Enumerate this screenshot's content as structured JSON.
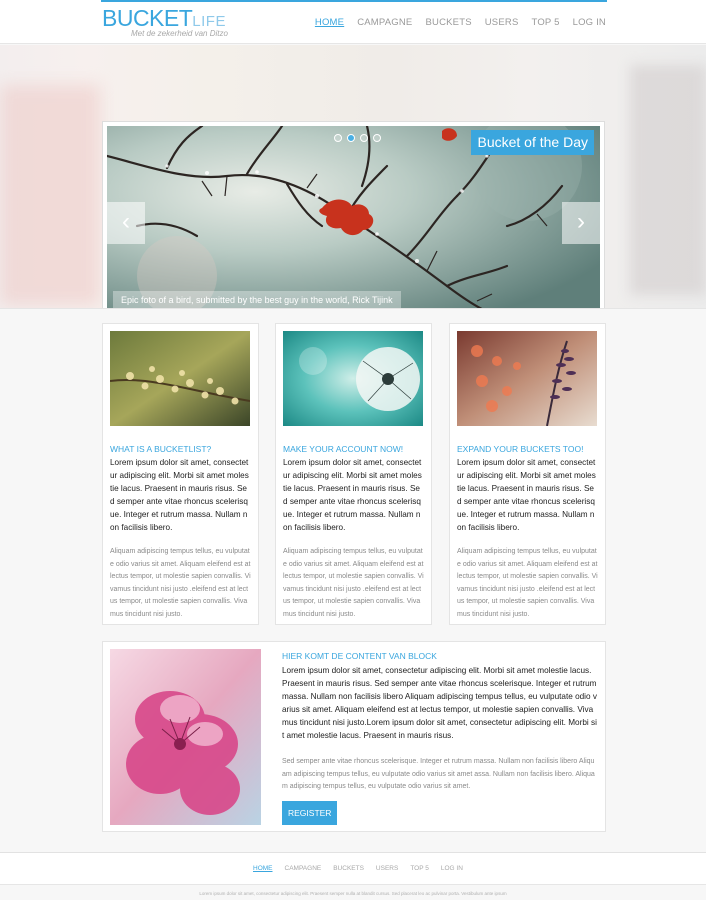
{
  "header": {
    "logo_main": "BUCKET",
    "logo_accent": "LIFE",
    "tagline": "Met de zekerheid van Ditzo",
    "nav": [
      {
        "label": "HOME",
        "active": true
      },
      {
        "label": "CAMPAGNE",
        "active": false
      },
      {
        "label": "BUCKETS",
        "active": false
      },
      {
        "label": "USERS",
        "active": false
      },
      {
        "label": "TOP 5",
        "active": false
      },
      {
        "label": "LOG IN",
        "active": false
      }
    ]
  },
  "slider": {
    "badge": "Bucket of the Day",
    "caption": "Epic foto of a bird, submitted by the best guy in the world, Rick Tijink",
    "dots": 4,
    "active_dot": 2,
    "prev_symbol": "‹",
    "next_symbol": "›"
  },
  "cards": [
    {
      "title": "WHAT IS A BUCKETLIST?",
      "lead": "Lorem ipsum dolor sit amet, consectetur adipiscing elit. Morbi sit amet molestie lacus. Praesent in mauris risus. Sed semper ante vitae rhoncus scelerisque. Integer et rutrum massa. Nullam non facilisis libero.",
      "body": "Aliquam adipiscing tempus tellus, eu vulputate odio varius sit amet. Aliquam eleifend est at lectus tempor, ut molestie sapien convallis. Vivamus tincidunt nisi justo .eleifend est at lectus tempor, ut molestie sapien convallis. Vivamus tincidunt nisi justo."
    },
    {
      "title": "MAKE YOUR ACCOUNT NOW!",
      "lead": "Lorem ipsum dolor sit amet, consectetur adipiscing elit. Morbi sit amet molestie lacus. Praesent in mauris risus. Sed semper ante vitae rhoncus scelerisque. Integer et rutrum massa. Nullam non facilisis libero.",
      "body": "Aliquam adipiscing tempus tellus, eu vulputate odio varius sit amet. Aliquam eleifend est at lectus tempor, ut molestie sapien convallis. Vivamus tincidunt nisi justo .eleifend est at lectus tempor, ut molestie sapien convallis. Vivamus tincidunt nisi justo."
    },
    {
      "title": "EXPAND YOUR BUCKETS TOO!",
      "lead": "Lorem ipsum dolor sit amet, consectetur adipiscing elit. Morbi sit amet molestie lacus. Praesent in mauris risus. Sed semper ante vitae rhoncus scelerisque. Integer et rutrum massa. Nullam non facilisis libero.",
      "body": "Aliquam adipiscing tempus tellus, eu vulputate odio varius sit amet. Aliquam eleifend est at lectus tempor, ut molestie sapien convallis. Vivamus tincidunt nisi justo .eleifend est at lectus tempor, ut molestie sapien convallis. Vivamus tincidunt nisi justo."
    }
  ],
  "block": {
    "title": "HIER KOMT DE CONTENT VAN BLOCK",
    "lead": "Lorem ipsum dolor sit amet, consectetur adipiscing elit. Morbi sit amet molestie lacus. Praesent in mauris risus. Sed semper ante vitae rhoncus scelerisque. Integer et rutrum massa. Nullam non facilisis libero Aliquam adipiscing tempus tellus, eu vulputate odio varius sit amet. Aliquam eleifend est at lectus tempor, ut molestie sapien convallis. Vivamus tincidunt nisi justo.Lorem ipsum dolor sit amet, consectetur adipiscing elit. Morbi sit amet molestie lacus. Praesent in mauris risus.",
    "body": "Sed semper ante vitae rhoncus scelerisque. Integer et rutrum massa. Nullam non facilisis libero Aliquam adipiscing tempus tellus, eu vulputate odio varius sit amet assa. Nullam non facilisis libero. Aliquam adipiscing tempus tellus, eu vulputate odio varius sit amet.",
    "button": "REGISTER"
  },
  "footer": {
    "nav": [
      {
        "label": "HOME",
        "active": true
      },
      {
        "label": "CAMPAGNE",
        "active": false
      },
      {
        "label": "BUCKETS",
        "active": false
      },
      {
        "label": "USERS",
        "active": false
      },
      {
        "label": "TOP 5",
        "active": false
      },
      {
        "label": "LOG IN",
        "active": false
      }
    ],
    "copyright": "Lorem ipsum dolor sit amet, consectetur adipiscing elit. Praesent semper nulla at blandit cursus. Sed placerat leo ac pulvinar porta. Vestibulum ante ipsum"
  },
  "colors": {
    "accent": "#3aa6de",
    "text_dark": "#222222",
    "text_muted": "#8a8a8a",
    "background": "#f7f7f7"
  }
}
